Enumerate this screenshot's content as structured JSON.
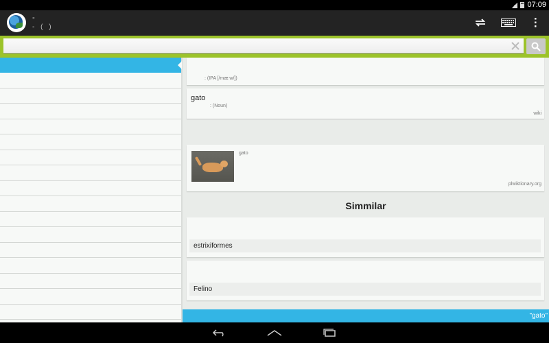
{
  "status": {
    "time": "07:09"
  },
  "actionbar": {
    "title": "-",
    "subtitle": "- ( )",
    "icons": [
      "swap-icon",
      "keyboard-icon",
      "overflow-menu-icon"
    ]
  },
  "search": {
    "value": "",
    "placeholder": ""
  },
  "cards": {
    "pronunciation": {
      "text": ": (IPA [/mæːw/])"
    },
    "translation": {
      "word": "gato",
      "pos": ": (Noun)",
      "source": "wiki"
    },
    "image": {
      "caption": "gato",
      "source": "plwiktionary.org"
    }
  },
  "similar": {
    "heading": "Simmilar",
    "items": [
      {
        "label": "estrixiformes"
      },
      {
        "label": "Felino"
      }
    ]
  },
  "bottombar": {
    "text": "\"gato\""
  },
  "colors": {
    "accent": "#33b5e5",
    "search_border": "#9cc32a",
    "actionbar": "#232323"
  }
}
